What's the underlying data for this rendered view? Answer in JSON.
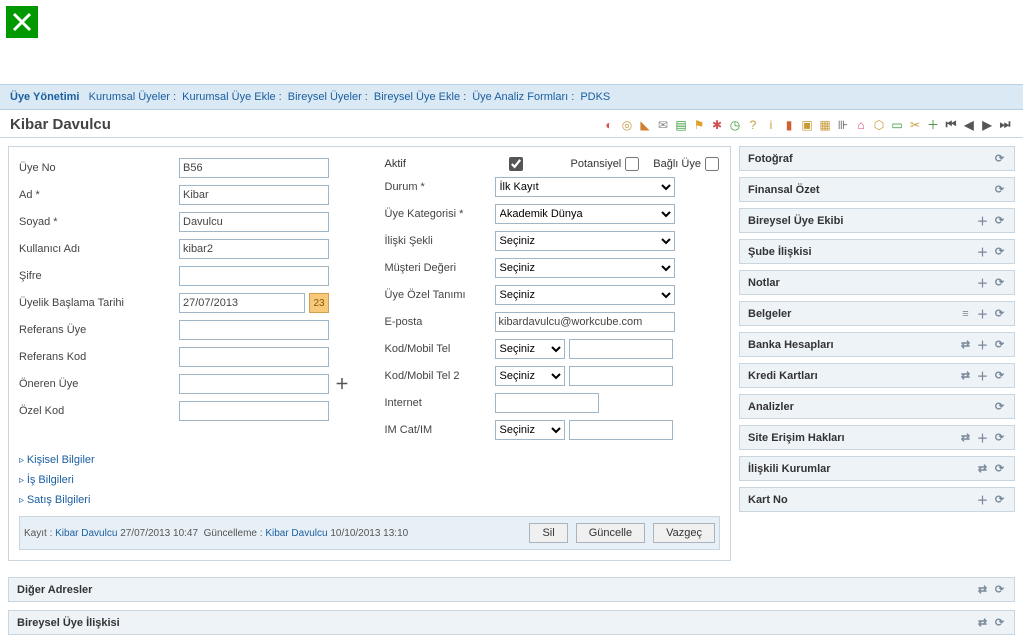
{
  "breadcrumb": {
    "title": "Üye Yönetimi",
    "items": [
      "Kurumsal Üyeler",
      "Kurumsal Üye Ekle",
      "Bireysel Üyeler",
      "Bireysel Üye Ekle",
      "Üye Analiz Formları",
      "PDKS"
    ]
  },
  "page_title": "Kibar Davulcu",
  "form_left": {
    "uye_no_label": "Üye No",
    "uye_no": "B56",
    "ad_label": "Ad *",
    "ad": "Kibar",
    "soyad_label": "Soyad *",
    "soyad": "Davulcu",
    "kullanici_label": "Kullanıcı Adı",
    "kullanici": "kibar2",
    "sifre_label": "Şifre",
    "sifre": "",
    "uyelik_tarih_label": "Üyelik Başlama Tarihi",
    "uyelik_tarih": "27/07/2013",
    "referans_uye_label": "Referans Üye",
    "referans_uye": "",
    "referans_kod_label": "Referans Kod",
    "referans_kod": "",
    "oneren_uye_label": "Öneren Üye",
    "oneren_uye": "",
    "ozel_kod_label": "Özel Kod",
    "ozel_kod": ""
  },
  "form_right": {
    "aktif_label": "Aktif",
    "potansiyel_label": "Potansiyel",
    "bagli_uye_label": "Bağlı Üye",
    "durum_label": "Durum *",
    "durum": "İlk Kayıt",
    "uye_kat_label": "Üye Kategorisi *",
    "uye_kat": "Akademik Dünya",
    "iliski_label": "İlişki Şekli",
    "iliski": "Seçiniz",
    "musteri_label": "Müşteri Değeri",
    "musteri": "Seçiniz",
    "ozel_tanim_label": "Üye Özel Tanımı",
    "ozel_tanim": "Seçiniz",
    "eposta_label": "E-posta",
    "eposta": "kibardavulcu@workcube.com",
    "kod_tel_label": "Kod/Mobil Tel",
    "kod_tel": "Seçiniz",
    "kod_tel2_label": "Kod/Mobil Tel 2",
    "kod_tel2": "Seçiniz",
    "internet_label": "Internet",
    "internet": "",
    "im_label": "IM Cat/IM",
    "im": "Seçiniz"
  },
  "collapsibles": [
    "Kişisel Bilgiler",
    "İş Bilgileri",
    "Satış Bilgileri"
  ],
  "footer": {
    "kayit_label": "Kayıt :",
    "kayit_user": "Kibar Davulcu",
    "kayit_time": "27/07/2013 10:47",
    "guncelleme_label": "Güncelleme :",
    "guncelleme_user": "Kibar Davulcu",
    "guncelleme_time": "10/10/2013 13:10",
    "sil": "Sil",
    "guncelle": "Güncelle",
    "vazgec": "Vazgeç"
  },
  "side_panels": [
    {
      "title": "Fotoğraf",
      "icons": [
        "refresh"
      ]
    },
    {
      "title": "Finansal Özet",
      "icons": [
        "refresh"
      ]
    },
    {
      "title": "Bireysel Üye Ekibi",
      "icons": [
        "plus",
        "refresh"
      ]
    },
    {
      "title": "Şube İlişkisi",
      "icons": [
        "plus",
        "refresh"
      ]
    },
    {
      "title": "Notlar",
      "icons": [
        "plus",
        "refresh"
      ]
    },
    {
      "title": "Belgeler",
      "icons": [
        "list",
        "plus",
        "refresh"
      ]
    },
    {
      "title": "Banka Hesapları",
      "icons": [
        "swap",
        "plus",
        "refresh"
      ]
    },
    {
      "title": "Kredi Kartları",
      "icons": [
        "swap",
        "plus",
        "refresh"
      ]
    },
    {
      "title": "Analizler",
      "icons": [
        "refresh"
      ]
    },
    {
      "title": "Site Erişim Hakları",
      "icons": [
        "swap",
        "plus",
        "refresh"
      ]
    },
    {
      "title": "İlişkili Kurumlar",
      "icons": [
        "swap",
        "refresh"
      ]
    },
    {
      "title": "Kart No",
      "icons": [
        "plus",
        "refresh"
      ]
    }
  ],
  "bottom_panels": [
    {
      "title": "Diğer Adresler",
      "icons": [
        "swap",
        "refresh"
      ]
    },
    {
      "title": "Bireysel Üye İlişkisi",
      "icons": [
        "swap",
        "refresh"
      ]
    }
  ]
}
